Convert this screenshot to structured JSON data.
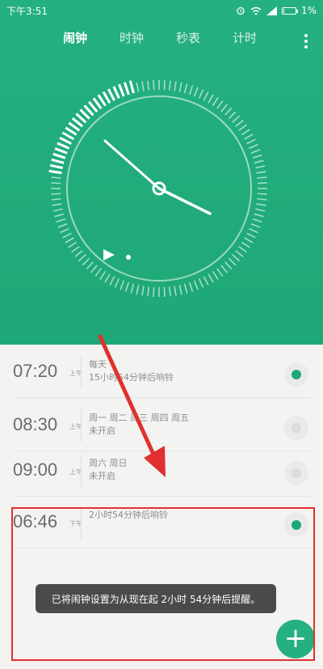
{
  "status_bar": {
    "time": "下午3:51",
    "battery": "1%"
  },
  "tabs": [
    {
      "label": "闹钟",
      "active": true
    },
    {
      "label": "时钟",
      "active": false
    },
    {
      "label": "秒表",
      "active": false
    },
    {
      "label": "计时",
      "active": false
    }
  ],
  "alarms": [
    {
      "time": "07:20",
      "ampm": "上午",
      "line1": "每天",
      "line2": "15小时54分钟后响铃",
      "enabled": true
    },
    {
      "time": "08:30",
      "ampm": "上午",
      "line1": "周一 周二 周三 周四 周五",
      "line2": "未开启",
      "enabled": false
    },
    {
      "time": "09:00",
      "ampm": "上午",
      "line1": "周六 周日",
      "line2": "未开启",
      "enabled": false
    },
    {
      "time": "06:46",
      "ampm": "下午",
      "line1": "2小时54分钟后响铃",
      "line2": "",
      "enabled": true
    }
  ],
  "toast": "已将闹钟设置为从现在起 2小时 54分钟后提醒。",
  "fab": "+",
  "colors": {
    "accent": "#1fa877",
    "header_bg": "#24b07f",
    "annotation": "#e03030"
  },
  "icons": [
    "alarm-status-icon",
    "wifi-icon",
    "signal-icon",
    "battery-icon",
    "more-menu-icon",
    "add-icon"
  ]
}
